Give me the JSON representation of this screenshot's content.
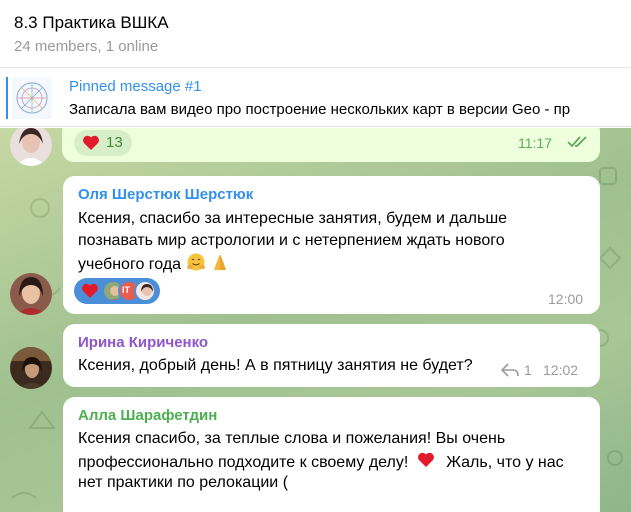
{
  "header": {
    "title": "8.3 Практика ВШКА",
    "subtitle": "24 members, 1 online"
  },
  "pinned": {
    "title": "Pinned message #1",
    "text": "Записала вам видео про построение нескольких карт в версии Geo - пр"
  },
  "messages": [
    {
      "reaction_count": "13",
      "time": "11:17"
    },
    {
      "sender": "Оля Шерстюк Шерстюк",
      "sender_color": "#3390ec",
      "lines": [
        "Ксения, спасибо за интересные занятия, будем и дальше",
        "познавать мир астрологии и с нетерпением ждать нового",
        "учебного года"
      ],
      "reaction_badge": "IT",
      "time": "12:00"
    },
    {
      "sender": "Ирина Кириченко",
      "sender_color": "#8e55c9",
      "text": "Ксения, добрый день! А в пятницу занятия не будет?",
      "replies": "1",
      "time": "12:02"
    },
    {
      "sender": "Алла Шарафетдин",
      "sender_color": "#4caf50",
      "lines": [
        "Ксения спасибо, за теплые слова и пожелания! Вы очень",
        "профессионально подходите к своему делу!",
        "Жаль, что у нас",
        "нет практики по релокации ("
      ]
    }
  ],
  "icons": [
    "heart-icon",
    "smiling-face-hands-icon",
    "folded-hands-icon",
    "reply-arrow-icon",
    "double-check-icon"
  ],
  "colors": {
    "accent": "#3390ec",
    "outgoing_bubble": "#eeffde",
    "reaction_blue": "#4b8fd8",
    "read_check": "#5ea95c"
  }
}
